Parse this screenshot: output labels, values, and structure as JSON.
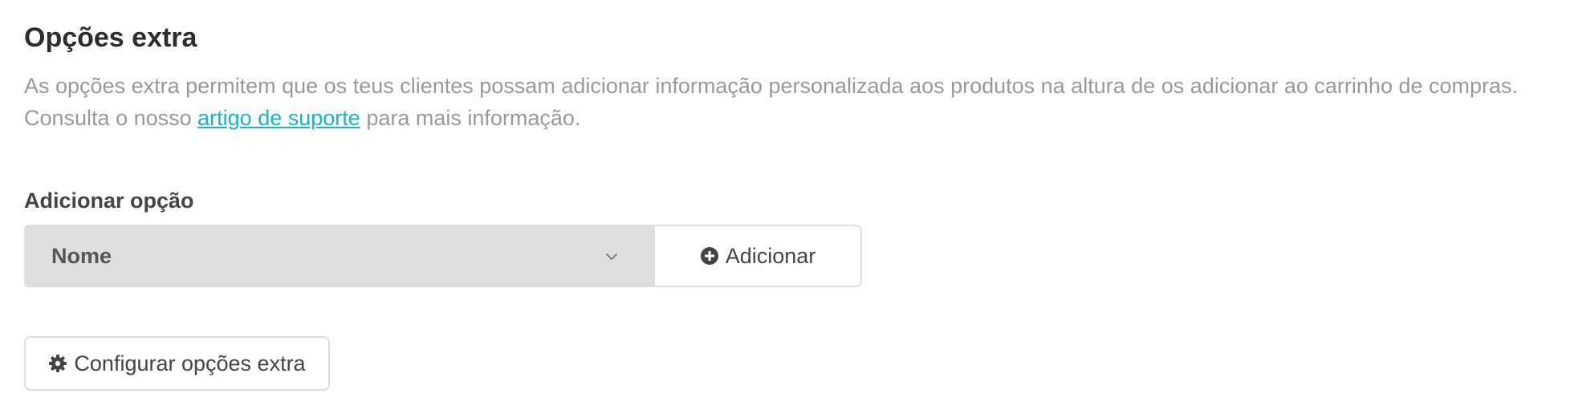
{
  "section": {
    "title": "Opções extra",
    "description_line1": "As opções extra permitem que os teus clientes possam adicionar informação personalizada aos produtos na altura de os adicionar ao carrinho de compras.",
    "description_line2_before": "Consulta o nosso",
    "description_link": "artigo de suporte",
    "description_line2_after": "para mais informação."
  },
  "add_option": {
    "label": "Adicionar opção",
    "select_value": "Nome",
    "add_button_label": "Adicionar",
    "add_icon": "plus-circle-icon",
    "select_icon": "chevron-down-icon"
  },
  "config_button": {
    "label": "Configurar opções extra",
    "icon": "gear-icon"
  },
  "colors": {
    "link": "#13b6cf",
    "select_bg": "#dedede",
    "border": "#dddddd"
  }
}
